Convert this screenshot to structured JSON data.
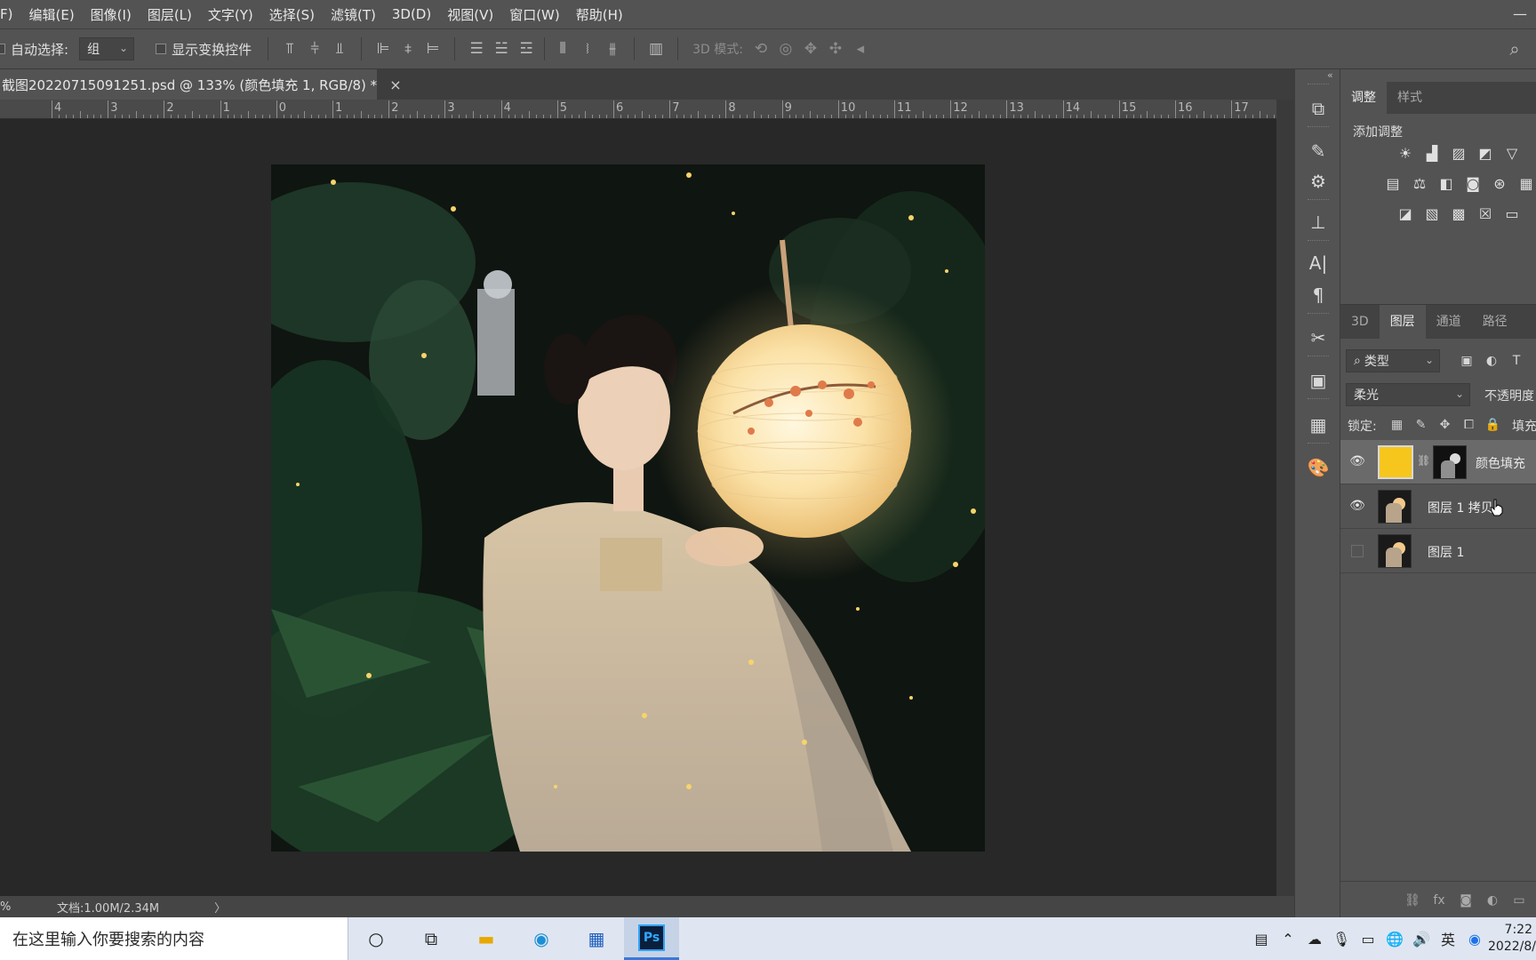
{
  "menu": [
    "F)",
    "编辑(E)",
    "图像(I)",
    "图层(L)",
    "文字(Y)",
    "选择(S)",
    "滤镜(T)",
    "3D(D)",
    "视图(V)",
    "窗口(W)",
    "帮助(H)"
  ],
  "options": {
    "auto_select_label": "自动选择:",
    "auto_select_value": "组",
    "show_transform_label": "显示变换控件",
    "mode_3d_label": "3D 模式:"
  },
  "document": {
    "tab_title": "截图20220715091251.psd @ 133% (颜色填充 1, RGB/8) *",
    "close": "×"
  },
  "ruler_labels": [
    "4",
    "3",
    "2",
    "1",
    "0",
    "1",
    "2",
    "3",
    "4",
    "5",
    "6",
    "7",
    "8",
    "9",
    "10",
    "11",
    "12",
    "13",
    "14",
    "15",
    "16",
    "17"
  ],
  "status": {
    "zoom": "%",
    "doc_info": "文档:1.00M/2.34M",
    "arrow": "〉"
  },
  "adjust_panel": {
    "tabs": [
      "调整",
      "样式"
    ],
    "active_tab": 0,
    "title": "添加调整"
  },
  "layers_panel": {
    "tabs": [
      "3D",
      "图层",
      "通道",
      "路径"
    ],
    "active_tab": 1,
    "kind_filter": "类型",
    "blend_mode": "柔光",
    "opacity_label": "不透明度",
    "lock_label": "锁定:",
    "fill_label": "填充",
    "layers": [
      {
        "name": "颜色填充",
        "visible": true,
        "selected": true,
        "type": "fill",
        "fill_color": "#f7c61c"
      },
      {
        "name": "图层 1 拷贝",
        "visible": true,
        "selected": false,
        "type": "pixel"
      },
      {
        "name": "图层 1",
        "visible": false,
        "selected": false,
        "type": "pixel"
      }
    ]
  },
  "taskbar": {
    "search_placeholder": "在这里输入你要搜索的内容",
    "time": "7:22",
    "date": "2022/8/"
  },
  "colors": {
    "app_bg": "#535353",
    "canvas_bg": "#282828",
    "fill_yellow": "#f7c61c",
    "taskbar_bg": "#dfe6f1"
  }
}
